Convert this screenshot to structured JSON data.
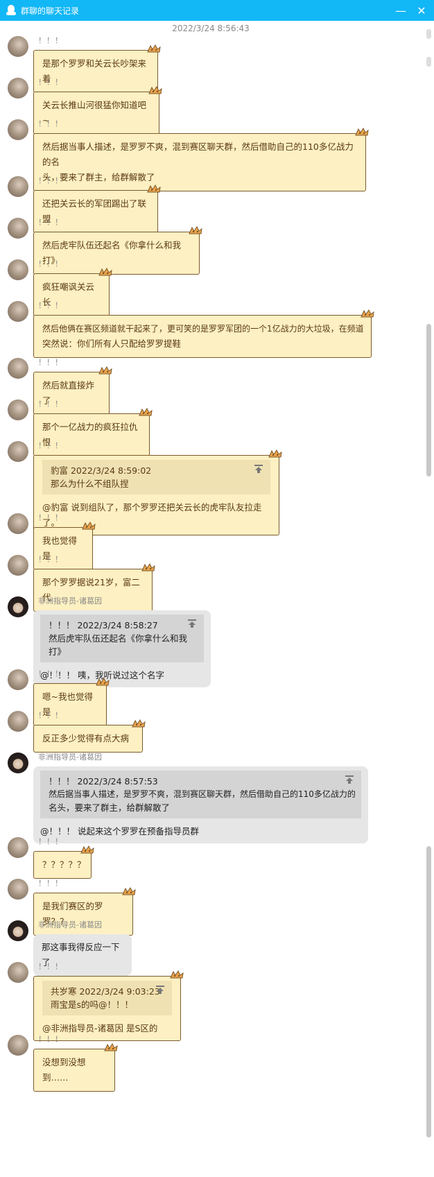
{
  "window": {
    "title": "群聊的聊天记录",
    "minimize": "—",
    "close": "✕"
  },
  "timestamp": "2022/3/24 8:56:43",
  "messages": [
    {
      "nick": "！！！",
      "text": "是那个罗罗和关云长吵架来着"
    },
    {
      "nick": "！！！",
      "text": "关云长推山河很猛你知道吧~"
    },
    {
      "nick": "！！！",
      "line1": "然后据当事人描述，是罗罗不爽，混到赛区聊天群，然后借助自己的110多亿战力的名",
      "line2": "头，要来了群主，给群解散了"
    },
    {
      "nick": "！！！",
      "text": "还把关云长的军团踢出了联盟"
    },
    {
      "nick": "！！！",
      "text": "然后虎牢队伍还起名《你拿什么和我打》"
    },
    {
      "nick": "！！！",
      "text": "疯狂嘲讽关云长"
    },
    {
      "nick": "！！！",
      "line1": "然后他俩在赛区频道就干起来了，更可笑的是罗罗军团的一个1亿战力的大垃圾，在频道",
      "line2": "突然说：你们所有人只配给罗罗提鞋"
    },
    {
      "nick": "！！！",
      "text": "然后就直接炸了"
    },
    {
      "nick": "！！！",
      "text": "那个一亿战力的疯狂拉仇恨"
    },
    {
      "nick": "！！！",
      "quote_head": "豹富  2022/3/24 8:59:02",
      "quote_text": "那么为什么不组队捏",
      "text": "@豹富  说到组队了，那个罗罗还把关云长的虎牢队友拉走了。"
    },
    {
      "nick": "！！！",
      "text": "我也觉得是"
    },
    {
      "nick": "！！！",
      "text": "那个罗罗据说21岁，富二代"
    },
    {
      "nick": "非洲指导员-诸葛因",
      "quote_head": "！！！   2022/3/24 8:58:27",
      "quote_text": "然后虎牢队伍还起名《你拿什么和我打》",
      "text": "@！！！  咦，我听说过这个名字"
    },
    {
      "nick": "！！！",
      "text": "嗯~我也觉得是"
    },
    {
      "nick": "！！！",
      "text": "反正多少觉得有点大病"
    },
    {
      "nick": "非洲指导员-诸葛因",
      "quote_head": "！！！   2022/3/24 8:57:53",
      "quote_line1": "然后据当事人描述，是罗罗不爽，混到赛区聊天群，然后借助自己的110多亿战力的",
      "quote_line2": "名头，要来了群主，给群解散了",
      "text": "@！！！  说起来这个罗罗在预备指导员群"
    },
    {
      "nick": "！！！",
      "text": "？？？？？"
    },
    {
      "nick": "！！！",
      "text": "是我们赛区的罗罗？？"
    },
    {
      "nick": "非洲指导员-诸葛因",
      "text": "那这事我得反应一下了"
    },
    {
      "nick": "！！！",
      "quote_head": "共岁寒  2022/3/24 9:03:23",
      "quote_text": "雨宝是s的吗@！！！",
      "text": "@非洲指导员-诸葛因 是S区的"
    },
    {
      "nick": "！！！",
      "text": "没想到没想到……"
    }
  ]
}
